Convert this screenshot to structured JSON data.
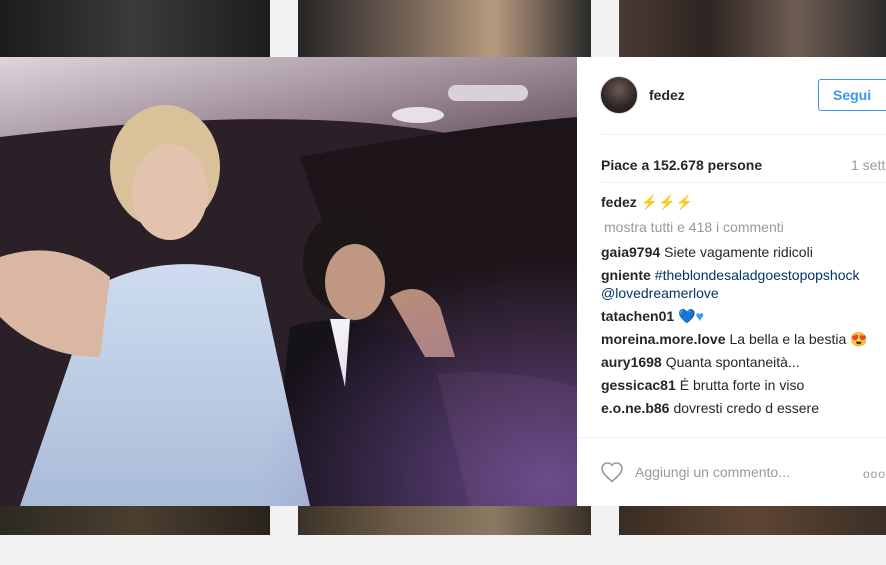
{
  "post": {
    "username": "fedez",
    "follow_label": "Segui",
    "likes_text": "Piace a 152.678 persone",
    "time_ago": "1 sett",
    "caption": {
      "author": "fedez",
      "text": "⚡⚡⚡"
    },
    "load_more_label": "mostra tutti e 418 i commenti",
    "comments": [
      {
        "author": "gaia9794",
        "text": "Siete vagamente ridicoli"
      },
      {
        "author": "gniente",
        "text": "#theblondesaladgoestopopshock @lovedreamerlove"
      },
      {
        "author": "tatachen01",
        "text": "💙♥"
      },
      {
        "author": "moreina.more.love",
        "text": "La bella e la bestia 😍"
      },
      {
        "author": "aury1698",
        "text": "Quanta spontaneità..."
      },
      {
        "author": "gessicac81",
        "text": "É brutta forte in viso"
      },
      {
        "author": "e.o.ne.b86",
        "text": "dovresti credo d essere"
      }
    ],
    "add_comment_placeholder": "Aggiungi un commento...",
    "more_options_label": "ooo"
  },
  "colors": {
    "accent": "#3897f0",
    "text": "#262626",
    "muted": "#999999"
  },
  "icons": {
    "like": "heart-icon",
    "more": "more-options-icon"
  }
}
